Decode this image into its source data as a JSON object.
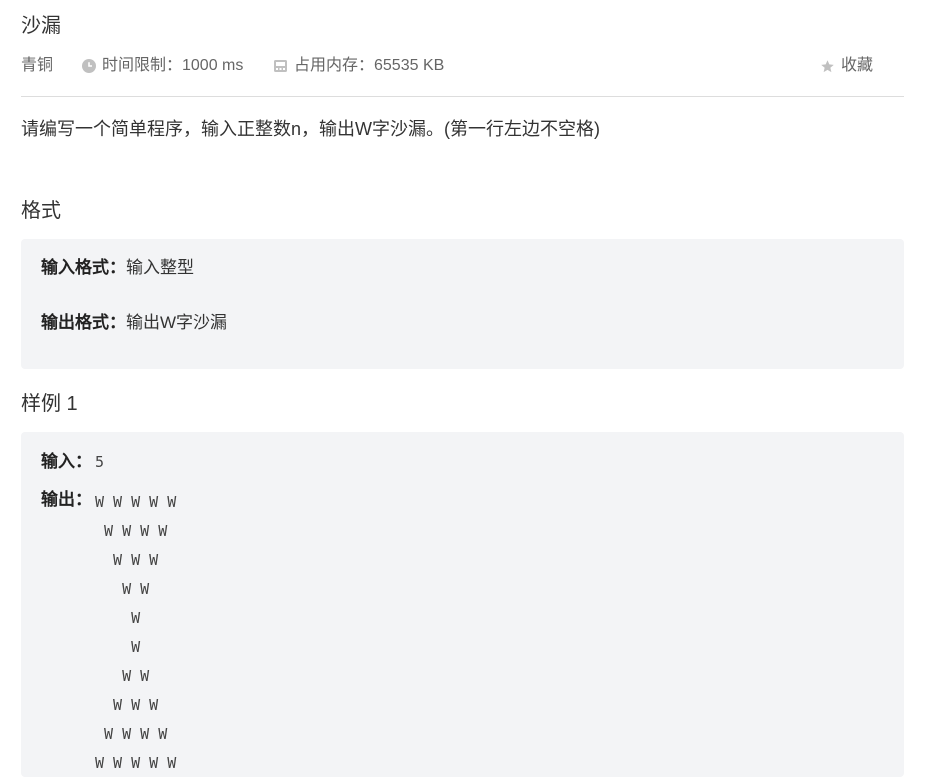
{
  "problem": {
    "title": "沙漏",
    "level": "青铜",
    "time_limit": "时间限制：1000 ms",
    "memory_limit": "占用内存：65535 KB",
    "favorite_label": "收藏",
    "description": "请编写一个简单程序，输入正整数n，输出W字沙漏。(第一行左边不空格)"
  },
  "format": {
    "heading": "格式",
    "input_label": "输入格式：",
    "input_text": "输入整型",
    "output_label": "输出格式：",
    "output_text": "输出W字沙漏"
  },
  "sample": {
    "heading": "样例 1",
    "input_label": "输入：",
    "input_value": "5",
    "output_label": "输出：",
    "output_lines": [
      "W W W W W",
      " W W W W",
      "  W W W",
      "   W W",
      "    W",
      "    W",
      "   W W",
      "  W W W",
      " W W W W",
      "W W W W W"
    ]
  },
  "icons": {
    "time": "clock-icon",
    "memory": "memory-chip-icon",
    "favorite": "star-icon"
  },
  "colors": {
    "box_bg": "#f3f4f6",
    "divider": "#dddddd",
    "icon_gray": "#c0c0c0"
  }
}
